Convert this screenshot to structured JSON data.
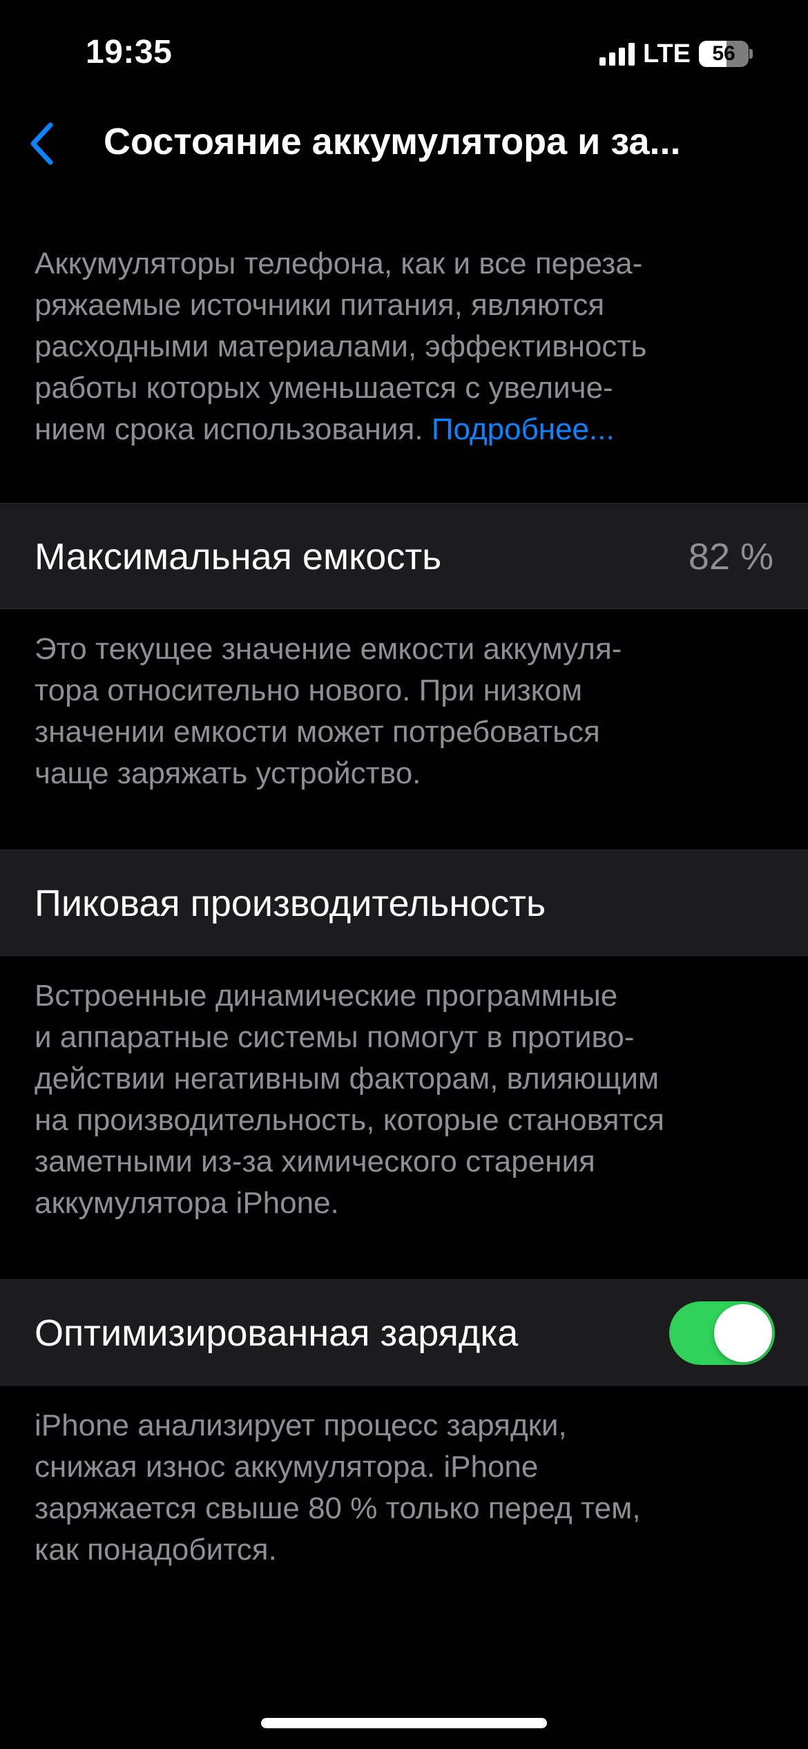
{
  "status_bar": {
    "time": "19:35",
    "network": "LTE",
    "battery_level": "56",
    "battery_fraction": 0.56,
    "signal_bars": 4,
    "icons": [
      "signal-icon",
      "battery-icon"
    ]
  },
  "nav": {
    "back_icon": "chevron-left-icon",
    "title": "Состояние аккумулятора и за..."
  },
  "intro": {
    "text": "Аккумуляторы телефона, как и все переза-\nряжаемые источники питания, являются\nрасходными материалами, эффективность\nработы которых уменьшается с увеличе-\nнием срока использования. ",
    "link_label": "Подробнее..."
  },
  "max_capacity": {
    "label": "Максимальная емкость",
    "value": "82 %",
    "description": "Это текущее значение емкости аккумуля-\nтора относительно нового. При низком\nзначении емкости может потребоваться\nчаще заряжать устройство."
  },
  "peak_performance": {
    "label": "Пиковая производительность",
    "description": "Встроенные динамические программные\nи аппаратные системы помогут в противо-\nдействии негативным факторам, влияющим\nна производительность, которые становятся\nзаметными из-за химического старения\nаккумулятора iPhone."
  },
  "optimized_charging": {
    "label": "Оптимизированная зарядка",
    "enabled": true,
    "description": "iPhone анализирует процесс зарядки,\nснижая износ аккумулятора. iPhone\nзаряжается свыше 80 % только перед тем,\nкак понадобится."
  },
  "colors": {
    "background": "#000000",
    "cell_background": "#1c1c1e",
    "secondary_text": "#8e8e93",
    "accent": "#0a84ff",
    "toggle_on": "#30d158"
  }
}
